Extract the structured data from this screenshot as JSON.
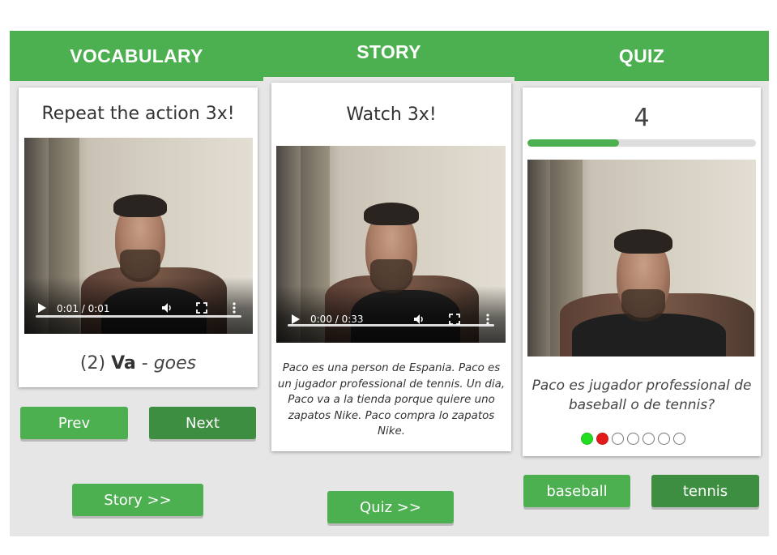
{
  "tabs": {
    "vocabulary": "VOCABULARY",
    "story": "STORY",
    "quiz": "QUIZ"
  },
  "vocabulary": {
    "instruction": "Repeat the action 3x!",
    "video": {
      "time": "0:01 / 0:01",
      "progress": 1.0
    },
    "word": {
      "index": "(2)",
      "spanish": "Va",
      "separator": "-",
      "english": "goes"
    },
    "prev_label": "Prev",
    "next_label": "Next",
    "story_link_label": "Story >>"
  },
  "story": {
    "instruction": "Watch 3x!",
    "video": {
      "time": "0:00 / 0:33",
      "progress": 0.0
    },
    "text": "Paco es una person de Espania. Paco es un jugador professional de tennis. Un dia, Paco va a la tienda porque quiere uno zapatos Nike. Paco compra lo zapatos Nike.",
    "quiz_link_label": "Quiz >>"
  },
  "quiz": {
    "counter": "4",
    "progress": 0.4,
    "question": "Paco es jugador professional de baseball o de tennis?",
    "answers_status": [
      "correct",
      "wrong",
      "pending",
      "pending",
      "pending",
      "pending",
      "pending"
    ],
    "options": [
      "baseball",
      "tennis"
    ]
  },
  "colors": {
    "accent": "#4caf50",
    "accent_dark": "#3e8e41",
    "correct": "#22dd22",
    "wrong": "#e31a1a",
    "background": "#e6e6e6"
  },
  "icons": [
    "play-icon",
    "volume-icon",
    "fullscreen-icon",
    "more-options-icon"
  ]
}
